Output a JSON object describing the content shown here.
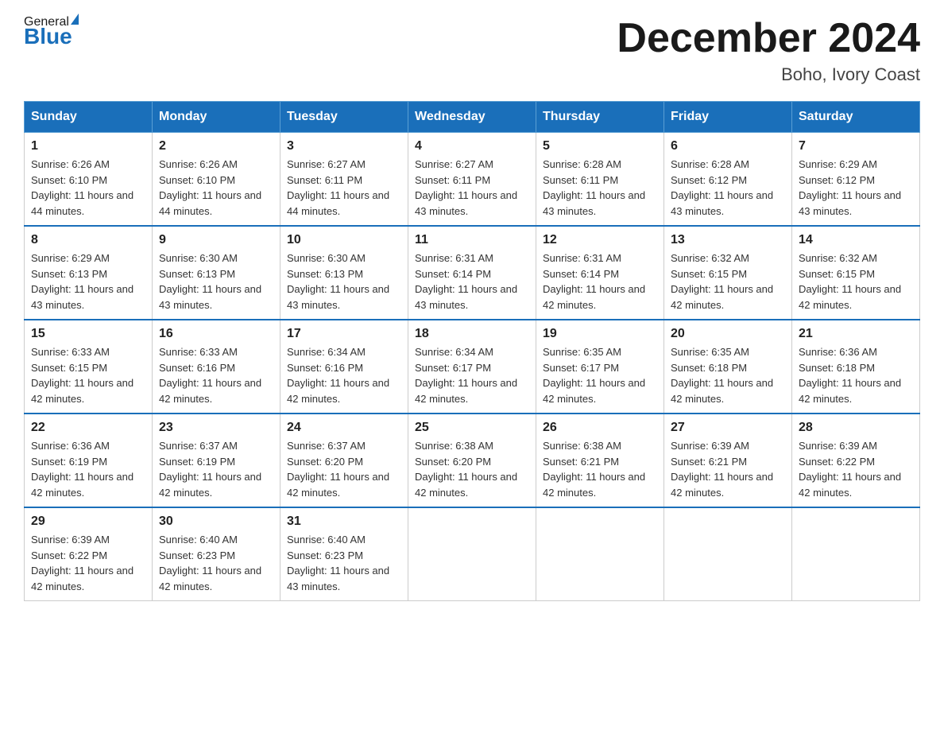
{
  "header": {
    "logo_general": "General",
    "logo_blue": "Blue",
    "month_title": "December 2024",
    "location": "Boho, Ivory Coast"
  },
  "days_of_week": [
    "Sunday",
    "Monday",
    "Tuesday",
    "Wednesday",
    "Thursday",
    "Friday",
    "Saturday"
  ],
  "weeks": [
    [
      {
        "num": "1",
        "sunrise": "6:26 AM",
        "sunset": "6:10 PM",
        "daylight": "11 hours and 44 minutes."
      },
      {
        "num": "2",
        "sunrise": "6:26 AM",
        "sunset": "6:10 PM",
        "daylight": "11 hours and 44 minutes."
      },
      {
        "num": "3",
        "sunrise": "6:27 AM",
        "sunset": "6:11 PM",
        "daylight": "11 hours and 44 minutes."
      },
      {
        "num": "4",
        "sunrise": "6:27 AM",
        "sunset": "6:11 PM",
        "daylight": "11 hours and 43 minutes."
      },
      {
        "num": "5",
        "sunrise": "6:28 AM",
        "sunset": "6:11 PM",
        "daylight": "11 hours and 43 minutes."
      },
      {
        "num": "6",
        "sunrise": "6:28 AM",
        "sunset": "6:12 PM",
        "daylight": "11 hours and 43 minutes."
      },
      {
        "num": "7",
        "sunrise": "6:29 AM",
        "sunset": "6:12 PM",
        "daylight": "11 hours and 43 minutes."
      }
    ],
    [
      {
        "num": "8",
        "sunrise": "6:29 AM",
        "sunset": "6:13 PM",
        "daylight": "11 hours and 43 minutes."
      },
      {
        "num": "9",
        "sunrise": "6:30 AM",
        "sunset": "6:13 PM",
        "daylight": "11 hours and 43 minutes."
      },
      {
        "num": "10",
        "sunrise": "6:30 AM",
        "sunset": "6:13 PM",
        "daylight": "11 hours and 43 minutes."
      },
      {
        "num": "11",
        "sunrise": "6:31 AM",
        "sunset": "6:14 PM",
        "daylight": "11 hours and 43 minutes."
      },
      {
        "num": "12",
        "sunrise": "6:31 AM",
        "sunset": "6:14 PM",
        "daylight": "11 hours and 42 minutes."
      },
      {
        "num": "13",
        "sunrise": "6:32 AM",
        "sunset": "6:15 PM",
        "daylight": "11 hours and 42 minutes."
      },
      {
        "num": "14",
        "sunrise": "6:32 AM",
        "sunset": "6:15 PM",
        "daylight": "11 hours and 42 minutes."
      }
    ],
    [
      {
        "num": "15",
        "sunrise": "6:33 AM",
        "sunset": "6:15 PM",
        "daylight": "11 hours and 42 minutes."
      },
      {
        "num": "16",
        "sunrise": "6:33 AM",
        "sunset": "6:16 PM",
        "daylight": "11 hours and 42 minutes."
      },
      {
        "num": "17",
        "sunrise": "6:34 AM",
        "sunset": "6:16 PM",
        "daylight": "11 hours and 42 minutes."
      },
      {
        "num": "18",
        "sunrise": "6:34 AM",
        "sunset": "6:17 PM",
        "daylight": "11 hours and 42 minutes."
      },
      {
        "num": "19",
        "sunrise": "6:35 AM",
        "sunset": "6:17 PM",
        "daylight": "11 hours and 42 minutes."
      },
      {
        "num": "20",
        "sunrise": "6:35 AM",
        "sunset": "6:18 PM",
        "daylight": "11 hours and 42 minutes."
      },
      {
        "num": "21",
        "sunrise": "6:36 AM",
        "sunset": "6:18 PM",
        "daylight": "11 hours and 42 minutes."
      }
    ],
    [
      {
        "num": "22",
        "sunrise": "6:36 AM",
        "sunset": "6:19 PM",
        "daylight": "11 hours and 42 minutes."
      },
      {
        "num": "23",
        "sunrise": "6:37 AM",
        "sunset": "6:19 PM",
        "daylight": "11 hours and 42 minutes."
      },
      {
        "num": "24",
        "sunrise": "6:37 AM",
        "sunset": "6:20 PM",
        "daylight": "11 hours and 42 minutes."
      },
      {
        "num": "25",
        "sunrise": "6:38 AM",
        "sunset": "6:20 PM",
        "daylight": "11 hours and 42 minutes."
      },
      {
        "num": "26",
        "sunrise": "6:38 AM",
        "sunset": "6:21 PM",
        "daylight": "11 hours and 42 minutes."
      },
      {
        "num": "27",
        "sunrise": "6:39 AM",
        "sunset": "6:21 PM",
        "daylight": "11 hours and 42 minutes."
      },
      {
        "num": "28",
        "sunrise": "6:39 AM",
        "sunset": "6:22 PM",
        "daylight": "11 hours and 42 minutes."
      }
    ],
    [
      {
        "num": "29",
        "sunrise": "6:39 AM",
        "sunset": "6:22 PM",
        "daylight": "11 hours and 42 minutes."
      },
      {
        "num": "30",
        "sunrise": "6:40 AM",
        "sunset": "6:23 PM",
        "daylight": "11 hours and 42 minutes."
      },
      {
        "num": "31",
        "sunrise": "6:40 AM",
        "sunset": "6:23 PM",
        "daylight": "11 hours and 43 minutes."
      },
      null,
      null,
      null,
      null
    ]
  ]
}
